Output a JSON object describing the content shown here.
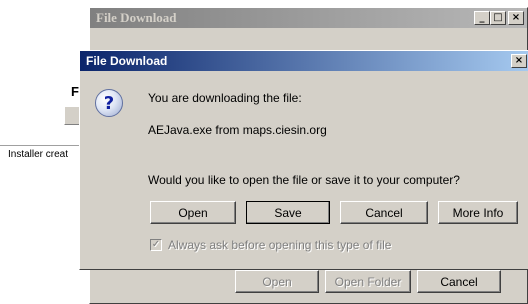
{
  "background": {
    "letter": "F",
    "status_text": "Installer creat"
  },
  "back_dialog": {
    "title": "File Download",
    "controls": {
      "minimize": "_",
      "maximize": "□",
      "close": "×"
    },
    "buttons": [
      "Open",
      "Open Folder",
      "Cancel"
    ]
  },
  "front_dialog": {
    "title": "File Download",
    "close": "×",
    "icon": "question-icon",
    "line1": "You are downloading the file:",
    "file_line": "AEJava.exe from maps.ciesin.org",
    "question": "Would you like to open the file or save it to your computer?",
    "buttons": {
      "open": "Open",
      "save": "Save",
      "cancel": "Cancel",
      "more_info": "More Info"
    },
    "checkbox": {
      "label": "Always ask before opening this type of file",
      "checked": true,
      "mark": "✓"
    }
  }
}
